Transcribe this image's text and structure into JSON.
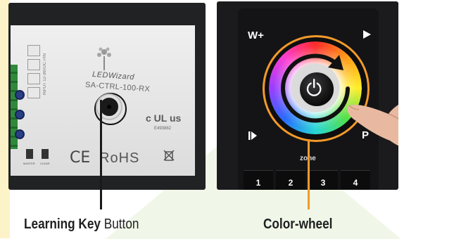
{
  "left_panel": {
    "device": {
      "brand": "LEDWizard",
      "model": "SA-CTRL-100-RX",
      "input_rating": "INPUT 12-36VDC PIN",
      "cert_mark": "c UL us",
      "cert_number": "E493882",
      "ce_mark": "CE",
      "rohs_mark": "RoHS",
      "switch_labels": [
        "MASTER",
        "CLEAR"
      ]
    },
    "callout": {
      "bold": "Learning Key",
      "rest": " Button",
      "line_color": "#1a1a1a"
    }
  },
  "right_panel": {
    "remote": {
      "top_left_label": "W+",
      "bottom_right_label": "P",
      "zone_label": "zone",
      "zone_keys": [
        "1",
        "2",
        "3",
        "4"
      ],
      "center_icon": "power-icon"
    },
    "callout": {
      "bold": "Color-wheel",
      "line_color": "#f39a2b"
    }
  },
  "colors": {
    "highlight": "#f39a2b",
    "photo_bg": "#1b1b1d",
    "background_shape": "#eef6e6"
  }
}
